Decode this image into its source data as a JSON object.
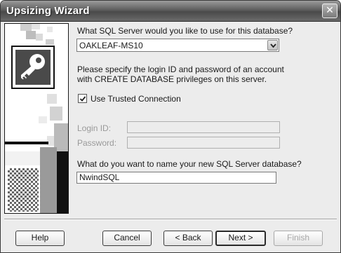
{
  "window": {
    "title": "Upsizing  Wizard",
    "close_glyph": "✕"
  },
  "server": {
    "question": "What SQL Server would you like to use for this database?",
    "selected": "OAKLEAF-MS10"
  },
  "login_instructions": {
    "line1": "Please specify the login ID and password of an account",
    "line2": "with CREATE DATABASE privileges on this server."
  },
  "trusted_connection": {
    "label": "Use Trusted Connection",
    "checked": true
  },
  "login": {
    "login_id_label": "Login ID:",
    "login_id_value": "",
    "password_label": "Password:",
    "password_value": ""
  },
  "database": {
    "question": "What do you want to name your new SQL Server database?",
    "name_value": "NwindSQL"
  },
  "buttons": {
    "help": "Help",
    "cancel": "Cancel",
    "back": "< Back",
    "next": "Next >",
    "finish": "Finish"
  },
  "icons": {
    "art_icon": "key-icon",
    "dropdown_icon": "chevron-down-icon",
    "check_icon": "checkmark-icon"
  }
}
